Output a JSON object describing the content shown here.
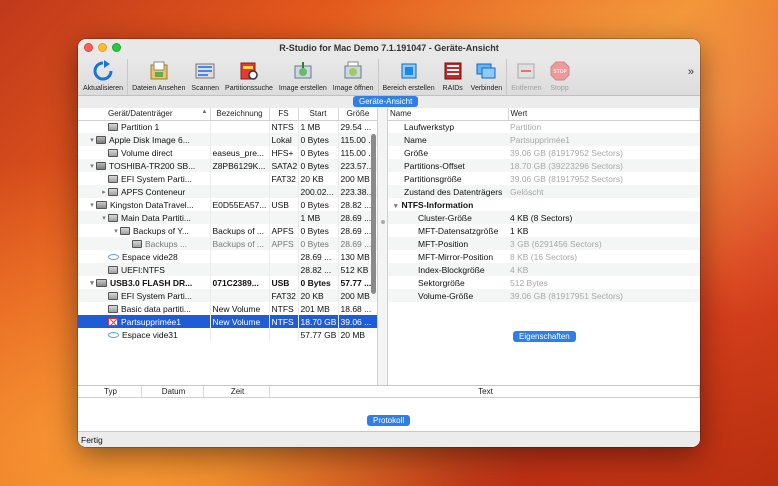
{
  "window": {
    "title": "R-Studio for Mac Demo 7.1.191047 - Geräte-Ansicht"
  },
  "toolbar": {
    "buttons": [
      {
        "label": "Aktualisieren",
        "icon": "refresh-icon",
        "enabled": true
      },
      {
        "label": "Dateien Ansehen",
        "icon": "folder-files-icon",
        "enabled": true
      },
      {
        "label": "Scannen",
        "icon": "scan-icon",
        "enabled": true
      },
      {
        "label": "Partitionssuche",
        "icon": "partition-search-icon",
        "enabled": true
      },
      {
        "label": "Image erstellen",
        "icon": "create-image-icon",
        "enabled": true
      },
      {
        "label": "Image öffnen",
        "icon": "open-image-icon",
        "enabled": true
      },
      {
        "label": "Bereich erstellen",
        "icon": "create-region-icon",
        "enabled": true
      },
      {
        "label": "RAIDs",
        "icon": "raid-icon",
        "enabled": true
      },
      {
        "label": "Verbinden",
        "icon": "connect-icon",
        "enabled": true
      },
      {
        "label": "Entfernen",
        "icon": "remove-icon",
        "enabled": false
      },
      {
        "label": "Stopp",
        "icon": "stop-icon",
        "enabled": false
      }
    ],
    "more": "»"
  },
  "view_tags": {
    "device_view": "Geräte-Ansicht",
    "properties": "Eigenschaften",
    "log": "Protokoll"
  },
  "device_table": {
    "columns": [
      "Gerät/Datenträger",
      "Bezeichnung",
      "FS",
      "Start",
      "Größe"
    ],
    "sort_indicator": "▲",
    "rows": [
      {
        "indent": 2,
        "tw": "",
        "icon": "part",
        "name": "Partition 1",
        "label": "",
        "fs": "NTFS",
        "start": "1 MB",
        "size": "29.54 ..."
      },
      {
        "indent": 1,
        "tw": "▾",
        "icon": "disk",
        "name": "Apple Disk Image 6...",
        "label": "",
        "fs": "Lokal",
        "start": "0 Bytes",
        "size": "115.00 ..."
      },
      {
        "indent": 2,
        "tw": "",
        "icon": "part",
        "name": "Volume direct",
        "label": "easeus_pre...",
        "fs": "HFS+",
        "start": "0 Bytes",
        "size": "115.00 ..."
      },
      {
        "indent": 1,
        "tw": "▾",
        "icon": "disk",
        "name": "TOSHIBA-TR200 SB...",
        "label": "Z8PB6129K...",
        "fs": "SATA2",
        "start": "0 Bytes",
        "size": "223.57..."
      },
      {
        "indent": 2,
        "tw": "",
        "icon": "part",
        "name": "EFI System Parti...",
        "label": "",
        "fs": "FAT32",
        "start": "20 KB",
        "size": "200 MB"
      },
      {
        "indent": 2,
        "tw": "▸",
        "icon": "part",
        "name": "APFS Conteneur",
        "label": "",
        "fs": "",
        "start": "200.02...",
        "size": "223.38..."
      },
      {
        "indent": 1,
        "tw": "▾",
        "icon": "usb",
        "name": "Kingston DataTravel...",
        "label": "E0D55EA57...",
        "fs": "USB",
        "start": "0 Bytes",
        "size": "28.82 ..."
      },
      {
        "indent": 2,
        "tw": "▾",
        "icon": "part",
        "name": "Main Data Partiti...",
        "label": "",
        "fs": "",
        "start": "1 MB",
        "size": "28.69 ..."
      },
      {
        "indent": 3,
        "tw": "▾",
        "icon": "part",
        "name": "Backups of Y...",
        "label": "Backups of ...",
        "fs": "APFS",
        "start": "0 Bytes",
        "size": "28.69 ..."
      },
      {
        "indent": 4,
        "tw": "",
        "icon": "part",
        "name": "Backups ...",
        "label": "Backups of ...",
        "fs": "APFS",
        "start": "0 Bytes",
        "size": "28.69 ...",
        "gray": true
      },
      {
        "indent": 2,
        "tw": "",
        "icon": "ell",
        "name": "Espace vide28",
        "label": "",
        "fs": "",
        "start": "28.69 ...",
        "size": "130 MB"
      },
      {
        "indent": 2,
        "tw": "",
        "icon": "part",
        "name": "UEFI:NTFS",
        "label": "",
        "fs": "",
        "start": "28.82 ...",
        "size": "512 KB"
      },
      {
        "indent": 1,
        "tw": "▾",
        "icon": "usb",
        "name": "USB3.0 FLASH DR...",
        "label": "071C2389...",
        "fs": "USB",
        "start": "0 Bytes",
        "size": "57.77 ...",
        "bold": true
      },
      {
        "indent": 2,
        "tw": "",
        "icon": "part",
        "name": "EFI System Parti...",
        "label": "",
        "fs": "FAT32",
        "start": "20 KB",
        "size": "200 MB"
      },
      {
        "indent": 2,
        "tw": "",
        "icon": "part",
        "name": "Basic data partiti...",
        "label": "New Volume",
        "fs": "NTFS",
        "start": "201 MB",
        "size": "18.68 ..."
      },
      {
        "indent": 2,
        "tw": "",
        "icon": "del",
        "name": "Partsupprimée1",
        "label": "New Volume",
        "fs": "NTFS",
        "start": "18.70 GB",
        "size": "39.06 ...",
        "selected": true
      },
      {
        "indent": 2,
        "tw": "",
        "icon": "ell",
        "name": "Espace vide31",
        "label": "",
        "fs": "",
        "start": "57.77 GB",
        "size": "20 MB"
      }
    ]
  },
  "properties": {
    "columns": [
      "Name",
      "Wert"
    ],
    "rows": [
      {
        "kind": "item",
        "key": "Laufwerkstyp",
        "value": "Partition"
      },
      {
        "kind": "item",
        "key": "Name",
        "value": "Partsupprimée1"
      },
      {
        "kind": "item",
        "key": "Größe",
        "value": "39.06 GB (81917952 Sectors)"
      },
      {
        "kind": "item",
        "key": "Partitions-Offset",
        "value": "18.70 GB (39223296 Sectors)"
      },
      {
        "kind": "item",
        "key": "Partitionsgröße",
        "value": "39.06 GB (81917952 Sectors)"
      },
      {
        "kind": "item",
        "key": "Zustand des Datenträgers",
        "value": "Gelöscht"
      },
      {
        "kind": "sec",
        "key": "NTFS-Information",
        "value": ""
      },
      {
        "kind": "sub",
        "key": "Cluster-Größe",
        "value": "4 KB (8 Sectors)",
        "dark": true
      },
      {
        "kind": "sub",
        "key": "MFT-Datensatzgröße",
        "value": "1 KB",
        "dark": true
      },
      {
        "kind": "sub",
        "key": "MFT-Position",
        "value": "3 GB (6291456 Sectors)"
      },
      {
        "kind": "sub",
        "key": "MFT-Mirror-Position",
        "value": "8 KB (16 Sectors)"
      },
      {
        "kind": "sub",
        "key": "Index-Blockgröße",
        "value": "4 KB"
      },
      {
        "kind": "sub",
        "key": "Sektorgröße",
        "value": "512 Bytes"
      },
      {
        "kind": "sub",
        "key": "Volume-Größe",
        "value": "39.06 GB (81917951 Sectors)"
      }
    ]
  },
  "log": {
    "columns": [
      "Typ",
      "Datum",
      "Zeit",
      "Text"
    ]
  },
  "status": {
    "text": "Fertig"
  }
}
